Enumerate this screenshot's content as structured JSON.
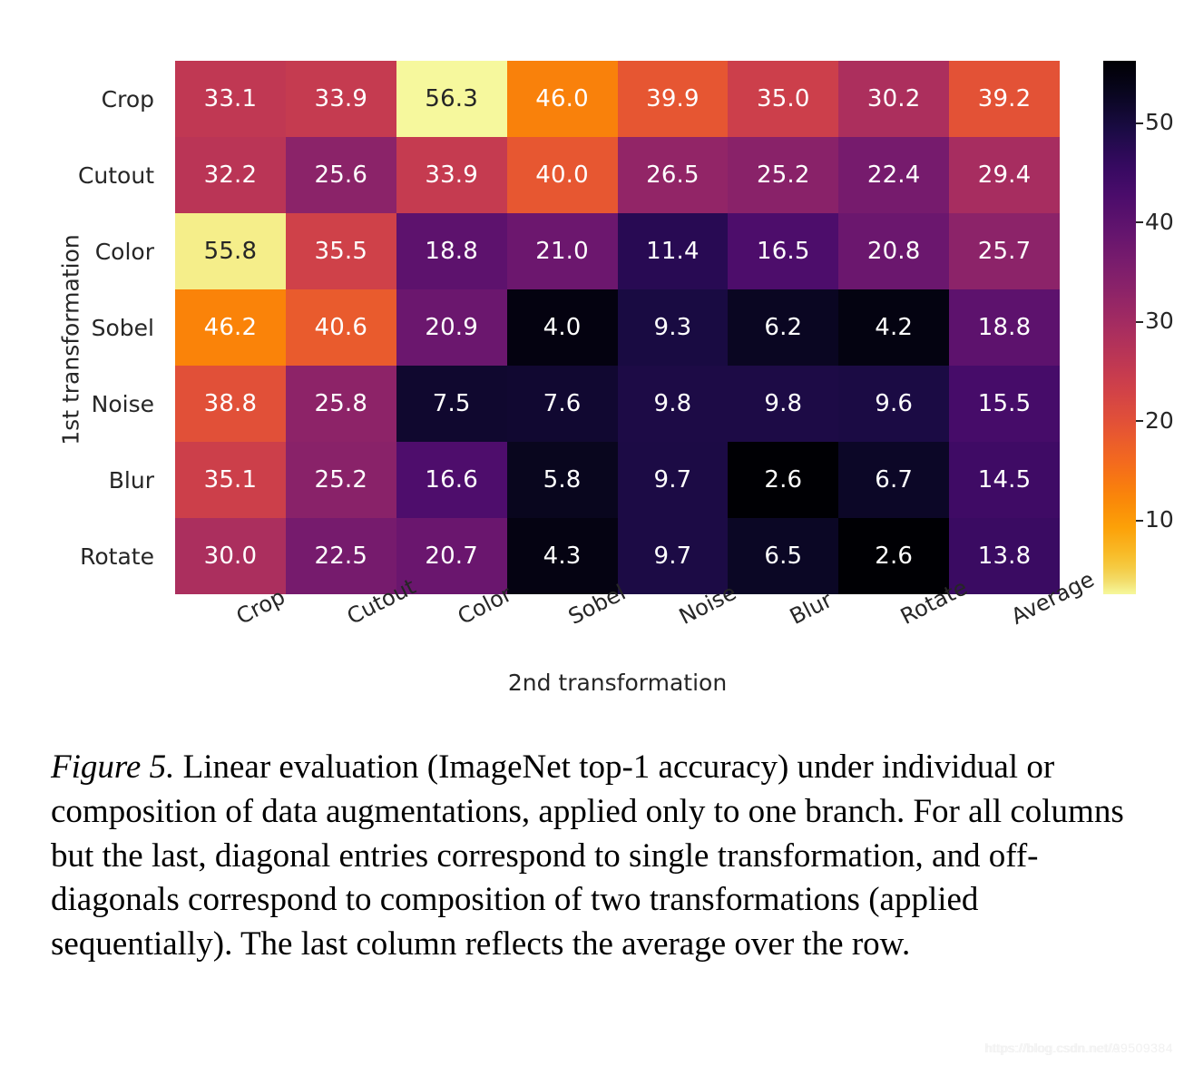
{
  "figure": {
    "ylabel": "1st transformation",
    "xlabel": "2nd transformation"
  },
  "colorbar": {
    "ticks": [
      "10",
      "20",
      "30",
      "40",
      "50"
    ],
    "tick_values": [
      10,
      20,
      30,
      40,
      50
    ],
    "colormap": "inferno",
    "vmin": 2.6,
    "vmax": 56.3
  },
  "caption": {
    "figno": "Figure 5.",
    "text": " Linear evaluation (ImageNet top-1 accuracy) under individual or composition of data augmentations, applied only to one branch. For all columns but the last, diagonal entries correspond to single transformation, and off-diagonals correspond to composition of two transformations (applied sequentially). The last column reflects the average over the row."
  },
  "watermark": {
    "line1": "https://blog.csdn.net/99509384",
    "line2": "https://blog.csdn.net/A9509384"
  },
  "chart_data": {
    "type": "heatmap",
    "title": "",
    "xlabel": "2nd transformation",
    "ylabel": "1st transformation",
    "colormap": "inferno",
    "colorbar_label": "",
    "colorbar_ticks": [
      10,
      20,
      30,
      40,
      50
    ],
    "vmin": 2.6,
    "vmax": 56.3,
    "grid": false,
    "legend_position": "right-colorbar",
    "x_categories": [
      "Crop",
      "Cutout",
      "Color",
      "Sobel",
      "Noise",
      "Blur",
      "Rotate",
      "Average"
    ],
    "y_categories": [
      "Crop",
      "Cutout",
      "Color",
      "Sobel",
      "Noise",
      "Blur",
      "Rotate"
    ],
    "annotations": "cell values shown as text, one decimal place",
    "rows": [
      {
        "label": "Crop",
        "values": [
          33.1,
          33.9,
          56.3,
          46.0,
          39.9,
          35.0,
          30.2,
          39.2
        ]
      },
      {
        "label": "Cutout",
        "values": [
          32.2,
          25.6,
          33.9,
          40.0,
          26.5,
          25.2,
          22.4,
          29.4
        ]
      },
      {
        "label": "Color",
        "values": [
          55.8,
          35.5,
          18.8,
          21.0,
          11.4,
          16.5,
          20.8,
          25.7
        ]
      },
      {
        "label": "Sobel",
        "values": [
          46.2,
          40.6,
          20.9,
          4.0,
          9.3,
          6.2,
          4.2,
          18.8
        ]
      },
      {
        "label": "Noise",
        "values": [
          38.8,
          25.8,
          7.5,
          7.6,
          9.8,
          9.8,
          9.6,
          15.5
        ]
      },
      {
        "label": "Blur",
        "values": [
          35.1,
          25.2,
          16.6,
          5.8,
          9.7,
          2.6,
          6.7,
          14.5
        ]
      },
      {
        "label": "Rotate",
        "values": [
          30.0,
          22.5,
          20.7,
          4.3,
          9.7,
          6.5,
          2.6,
          13.8
        ]
      }
    ],
    "values": [
      [
        33.1,
        33.9,
        56.3,
        46.0,
        39.9,
        35.0,
        30.2,
        39.2
      ],
      [
        32.2,
        25.6,
        33.9,
        40.0,
        26.5,
        25.2,
        22.4,
        29.4
      ],
      [
        55.8,
        35.5,
        18.8,
        21.0,
        11.4,
        16.5,
        20.8,
        25.7
      ],
      [
        46.2,
        40.6,
        20.9,
        4.0,
        9.3,
        6.2,
        4.2,
        18.8
      ],
      [
        38.8,
        25.8,
        7.5,
        7.6,
        9.8,
        9.8,
        9.6,
        15.5
      ],
      [
        35.1,
        25.2,
        16.6,
        5.8,
        9.7,
        2.6,
        6.7,
        14.5
      ],
      [
        30.0,
        22.5,
        20.7,
        4.3,
        9.7,
        6.5,
        2.6,
        13.8
      ]
    ]
  }
}
